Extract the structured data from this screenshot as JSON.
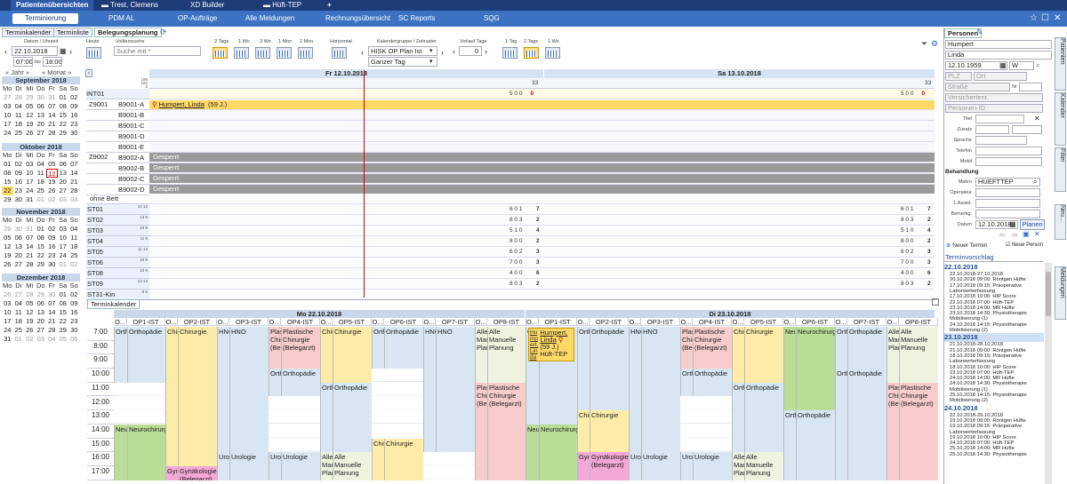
{
  "titlebar": {
    "tabs": [
      "Patientenübersichten",
      "Trest, Clemens",
      "XD Builder",
      "Hüft-TEP",
      "+"
    ]
  },
  "nav": {
    "items": [
      "Terminierung",
      "PDM AL",
      "OP-Aufträge",
      "Alle Meldungen",
      "Rechnungsübersicht",
      "SC Reports",
      "SQG"
    ]
  },
  "subtabs": [
    "Terminkalender",
    "Terminliste",
    "Belegungsplanung"
  ],
  "toolbar": {
    "datum_label": "Datum / Uhrzeit",
    "datum": "22.10.2018",
    "from": "07:00",
    "bis": "bis",
    "to": "18:00",
    "heute": "Heute",
    "volltext_label": "Volltextsuche",
    "search_placeholder": "Suche mit *",
    "view_labels": [
      "2 Tage",
      "1 Wo",
      "3 Wo",
      "1 Mon",
      "2 Mon"
    ],
    "horizontal": "Horizontal",
    "kalendergruppe_label": "Kalendergruppe / Zeitraster",
    "kalendergruppe": "HISK OP Plan Ist",
    "zeitraster": "Ganzer Tag",
    "vorlauf_label": "Vorlauf Tage",
    "vorlauf": "0",
    "right_labels": [
      "1 Tag",
      "2 Tage",
      "1 Wo"
    ]
  },
  "calnav": {
    "year": "« Jahr »",
    "month": "« Monat »"
  },
  "minical": {
    "headers": [
      "Mo",
      "Di",
      "Mi",
      "Do",
      "Fr",
      "Sa",
      "So"
    ],
    "months": [
      {
        "name": "September 2018",
        "rows": [
          [
            "27",
            "28",
            "29",
            "30",
            "31",
            "01",
            "02"
          ],
          [
            "03",
            "04",
            "05",
            "06",
            "07",
            "08",
            "09"
          ],
          [
            "10",
            "11",
            "12",
            "13",
            "14",
            "15",
            "16"
          ],
          [
            "17",
            "18",
            "19",
            "20",
            "21",
            "22",
            "23"
          ],
          [
            "24",
            "25",
            "26",
            "27",
            "28",
            "29",
            "30"
          ]
        ]
      },
      {
        "name": "Oktober 2018",
        "rows": [
          [
            "01",
            "02",
            "03",
            "04",
            "05",
            "06",
            "07"
          ],
          [
            "08",
            "09",
            "10",
            "11",
            "12",
            "13",
            "14"
          ],
          [
            "15",
            "16",
            "17",
            "18",
            "19",
            "20",
            "21"
          ],
          [
            "22",
            "23",
            "24",
            "25",
            "26",
            "27",
            "28"
          ],
          [
            "29",
            "30",
            "31",
            "01",
            "02",
            "03",
            "04"
          ]
        ]
      },
      {
        "name": "November 2018",
        "rows": [
          [
            "29",
            "30",
            "31",
            "01",
            "02",
            "03",
            "04"
          ],
          [
            "05",
            "06",
            "07",
            "08",
            "09",
            "10",
            "11"
          ],
          [
            "12",
            "13",
            "14",
            "15",
            "16",
            "17",
            "18"
          ],
          [
            "19",
            "20",
            "21",
            "22",
            "23",
            "24",
            "25"
          ],
          [
            "26",
            "27",
            "28",
            "29",
            "30",
            "01",
            "02"
          ]
        ]
      },
      {
        "name": "Dezember 2018",
        "rows": [
          [
            "26",
            "27",
            "28",
            "29",
            "30",
            "01",
            "02"
          ],
          [
            "03",
            "04",
            "05",
            "06",
            "07",
            "08",
            "09"
          ],
          [
            "10",
            "11",
            "12",
            "13",
            "14",
            "15",
            "16"
          ],
          [
            "17",
            "18",
            "19",
            "20",
            "21",
            "22",
            "23"
          ],
          [
            "24",
            "25",
            "26",
            "27",
            "28",
            "29",
            "30"
          ],
          [
            "31",
            "01",
            "02",
            "03",
            "04",
            "05",
            "06"
          ]
        ]
      }
    ]
  },
  "beleg": {
    "day1": "Fr 12.10.2018",
    "day2": "Sa 13.10.2018",
    "cap1": "33",
    "cap2": "33",
    "top_ticks": [
      "186",
      "192",
      "6"
    ],
    "wards": [
      {
        "label": "INT01",
        "nums": "5 0 0",
        "n2": "0",
        "nums2": "5 0 0",
        "n22": "0"
      }
    ],
    "beds": [
      "B9001-A",
      "B9001-B",
      "B9001-C",
      "B9001-D",
      "B9001-E",
      "B9002-A",
      "B9002-B",
      "B9002-C",
      "B9002-D"
    ],
    "z1": "Z9001",
    "z2": "Z9002",
    "ohne": "ohne Bett",
    "patient": "Humpert, Linda",
    "patient_age": "(59 J.)",
    "gesperrt": "Gesperrt",
    "stations": [
      {
        "name": "ST01",
        "t": "14 12",
        "a": "6 0 1",
        "b": "7",
        "c": "6 0 1",
        "d": "7"
      },
      {
        "name": "ST02",
        "t": "13 9",
        "a": "8 0 3",
        "b": "2",
        "c": "8 0 3",
        "d": "2"
      },
      {
        "name": "ST03",
        "t": "10 9",
        "a": "5 1 0",
        "b": "4",
        "c": "5 1 0",
        "d": "4"
      },
      {
        "name": "ST04",
        "t": "11 9",
        "a": "8 0 0",
        "b": "2",
        "c": "8 0 0",
        "d": "2"
      },
      {
        "name": "ST05",
        "t": "11 12",
        "a": "6 0 2",
        "b": "3",
        "c": "6 0 2",
        "d": "3"
      },
      {
        "name": "ST06",
        "t": "10 9",
        "a": "7 0 0",
        "b": "3",
        "c": "7 0 0",
        "d": "3"
      },
      {
        "name": "ST08",
        "t": "10 9",
        "a": "4 0 0",
        "b": "6",
        "c": "4 0 0",
        "d": "6"
      },
      {
        "name": "ST09",
        "t": "13 12",
        "a": "8 0 3",
        "b": "2",
        "c": "8 0 3",
        "d": "2"
      },
      {
        "name": "ST31-Kin",
        "t": "9 6",
        "a": "",
        "b": "",
        "c": "",
        "d": ""
      }
    ]
  },
  "terminkalender": {
    "tab": "Terminkalender",
    "day1": "Mo 22.10.2018",
    "day2": "Di 23.10.2018",
    "cols": [
      "O...",
      "OP1-IST",
      "O...",
      "OP2-IST",
      "O...",
      "OP3-IST",
      "O...",
      "OP4-IST",
      "O...",
      "OP5-IST",
      "O...",
      "OP6-IST",
      "O...",
      "OP7-IST",
      "O...",
      "OP8-IST"
    ],
    "times": [
      "7:00",
      "8:00",
      "9:00",
      "10:00",
      "11:00",
      "12:00",
      "13:00",
      "14:00",
      "15:00",
      "16:00",
      "17:00"
    ],
    "blocks": {
      "ortho": "Orthopädie",
      "ortho_s": "Orth",
      "chir": "Chirurgie",
      "chir_s": "Chir",
      "hno": "HNO",
      "hno_s": "HNC",
      "plast": "Plastische Chirurgie (Belegarzt)",
      "plast_s": "Plas Chir (Bele",
      "neuro": "Neurochirurgie",
      "neuro_s": "Neu",
      "gyn": "Gynäkologie (Belegarzt)",
      "gyn_s": "Gyn",
      "uro": "Urologie",
      "uro_s": "Urol",
      "alle": "Alle Manuelle Planung",
      "alle_s": "Alle Mani Plan",
      "patient": "Humpert, Linda",
      "patient_s": "Hu mp ert, Lin da",
      "age": "(59 J.)",
      "hueft": "Hüft-TEP"
    }
  },
  "right": {
    "tab1": "Personen",
    "surname": "Humpert",
    "firstname": "Linda",
    "dob": "12.10.1959",
    "sex": "W",
    "plz": "PLZ",
    "ort": "Ort",
    "strasse": "Straße",
    "nr": "Nr",
    "versicherte": "Versichertenr.",
    "personen_id": "Personen-ID",
    "labels": [
      "Titel",
      "Zusatz",
      "Sprache",
      "Telefon",
      "Mobil"
    ],
    "behandlung": "Behandlung",
    "makro_label": "Makro",
    "makro": "HUEFTTEP",
    "operateur": "Operateur",
    "assist": "1.Assist.",
    "bemerkung": "Bemerkg.",
    "datum_label": "Datum",
    "datum": "12.10.2018",
    "planen": "Planen",
    "neuer_termin": "Neuer Termin",
    "neue_person": "Neue Person",
    "terminvorschlag": "Terminvorschlag",
    "vtabs": [
      "Patienten",
      "Kalender",
      "Filter",
      "Neu...",
      "Meldungen"
    ],
    "suggestions": [
      {
        "date": "22.10.2018",
        "lines": [
          "22.10.2018-27.10.2018",
          "20.10.2018 09:00: Röntgen Hüfte",
          "17.10.2018 09:15: Präoperative",
          "Laborwerterfassung",
          "17.10.2018 10:00: HIP Score",
          "22.10.2018 07:00: Hüft-TEP",
          "23.10.2018 14:00: MR Hüfte",
          "23.10.2018 14:30: Physiotherapie",
          "Mobilisierung (1)",
          "24.10.2018 14:15: Physiotherapie",
          "Mobilisierung (2)"
        ]
      },
      {
        "date": "23.10.2018",
        "lines": [
          "21.10.2018-28.10.2018",
          "21.10.2018 09:00: Röntgen Hüfte",
          "18.10.2018 09:15: Präoperative",
          "Laborwerterfassung",
          "18.10.2018 10:00: HIP Score",
          "23.10.2018 07:00: Hüft-TEP",
          "24.10.2018 14:00: MR Hüfte",
          "24.10.2018 14:30: Physiotherapie",
          "Mobilisierung (1)",
          "25.10.2018 14:15: Physiotherapie",
          "Mobilisierung (2)"
        ]
      },
      {
        "date": "24.10.2018",
        "lines": [
          "22.10.2018-29.10.2018",
          "19.10.2018 09:00: Röntgen Hüfte",
          "19.10.2018 09:15: Präoperative",
          "Laborwerterfassung",
          "19.10.2018 10:00: HIP Score",
          "24.10.2018 07:00: Hüft-TEP",
          "25.10.2018 14:00: MR Hüfte",
          "25.10.2018 14:30: Physiotherapie"
        ]
      }
    ]
  },
  "colors": {
    "titlebar": "#1e3c78",
    "navbar": "#3b72c2",
    "nowline": "#cc0000",
    "patient": "#ffd966"
  }
}
